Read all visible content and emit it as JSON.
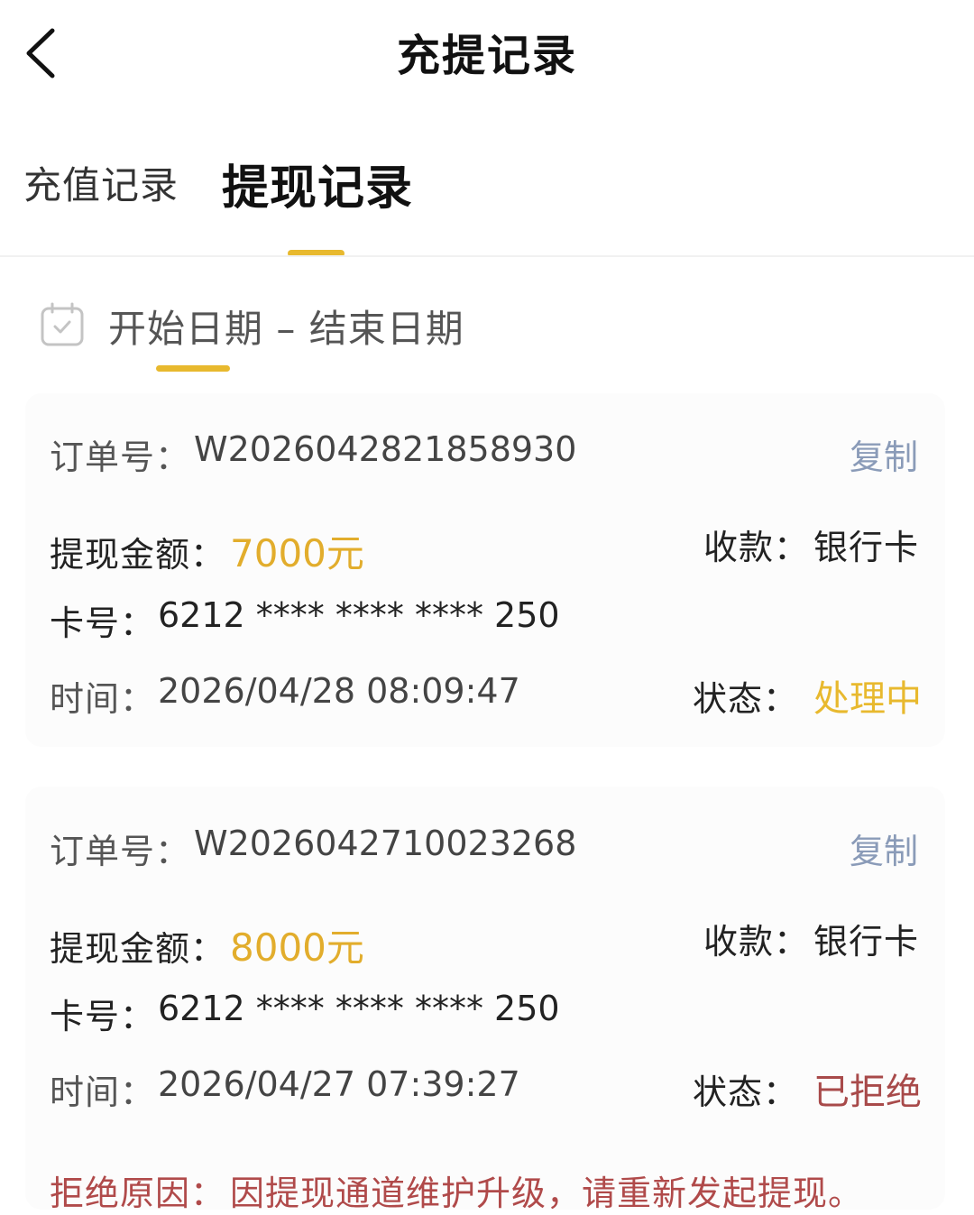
{
  "header": {
    "title": "充提记录",
    "back_icon": "chevron-left-icon"
  },
  "tabs": [
    {
      "label": "充值记录",
      "active": false
    },
    {
      "label": "提现记录",
      "active": true
    }
  ],
  "filter": {
    "date_range": "开始日期 – 结束日期",
    "icon": "calendar-icon"
  },
  "colors": {
    "accent": "#e8b92e",
    "amount": "#e2ad2c",
    "rejected": "#a84a4a",
    "copy": "#8a9bb8"
  },
  "records": [
    {
      "order_label": "订单号：",
      "order_no": "W2026042821858930",
      "copy_label": "复制",
      "amount_label": "提现金额：",
      "amount": "7000元",
      "receive_label": "收款：",
      "receive_method": "银行卡",
      "card_label": "卡号：",
      "card_no": "6212 **** **** **** 250",
      "time_label": "时间：",
      "time": "2026/04/28 08:09:47",
      "status_label": "状态：",
      "status": "处理中"
    },
    {
      "order_label": "订单号：",
      "order_no": "W2026042710023268",
      "copy_label": "复制",
      "amount_label": "提现金额：",
      "amount": "8000元",
      "receive_label": "收款：",
      "receive_method": "银行卡",
      "card_label": "卡号：",
      "card_no": "6212 **** **** **** 250",
      "time_label": "时间：",
      "time": "2026/04/27 07:39:27",
      "status_label": "状态：",
      "status": "已拒绝",
      "reject_reason_label": "拒绝原因：",
      "reject_reason": "因提现通道维护升级，请重新发起提现。"
    }
  ]
}
